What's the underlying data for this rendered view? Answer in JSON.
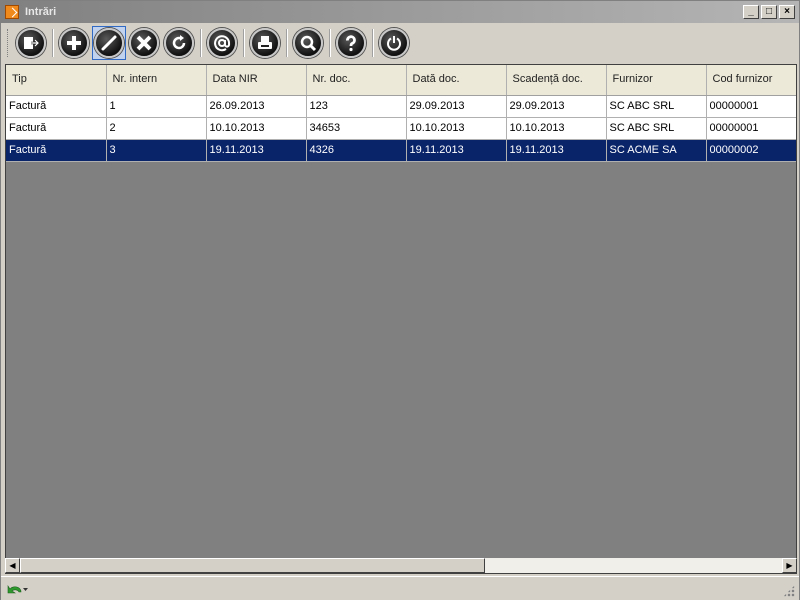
{
  "window": {
    "title": "Intrări"
  },
  "window_controls": {
    "minimize": "_",
    "maximize": "□",
    "close": "×"
  },
  "toolbar": {
    "buttons": [
      {
        "name": "exit-button",
        "icon": "exit-icon"
      },
      {
        "name": "add-button",
        "icon": "plus-icon"
      },
      {
        "name": "edit-button",
        "icon": "pencil-icon",
        "active": true
      },
      {
        "name": "delete-button",
        "icon": "x-icon"
      },
      {
        "name": "refresh-button",
        "icon": "refresh-icon"
      },
      {
        "name": "email-button",
        "icon": "at-icon"
      },
      {
        "name": "print-button",
        "icon": "printer-icon"
      },
      {
        "name": "search-button",
        "icon": "magnifier-icon"
      },
      {
        "name": "help-button",
        "icon": "question-icon"
      },
      {
        "name": "power-button",
        "icon": "power-icon"
      }
    ]
  },
  "grid": {
    "columns": [
      "Tip",
      "Nr. intern",
      "Data NIR",
      "Nr. doc.",
      "Dată doc.",
      "Scadență doc.",
      "Furnizor",
      "Cod furnizor"
    ],
    "rows": [
      [
        "Factură",
        "1",
        "26.09.2013",
        "123",
        "29.09.2013",
        "29.09.2013",
        "SC ABC SRL",
        "00000001"
      ],
      [
        "Factură",
        "2",
        "10.10.2013",
        "34653",
        "10.10.2013",
        "10.10.2013",
        "SC ABC SRL",
        "00000001"
      ],
      [
        "Factură",
        "3",
        "19.11.2013",
        "4326",
        "19.11.2013",
        "19.11.2013",
        "SC ACME SA",
        "00000002"
      ]
    ],
    "selected_row": 3
  },
  "scrollbar": {
    "left_arrow": "◀",
    "right_arrow": "▶",
    "position_fraction": 0.61
  },
  "statusbar": {
    "icon": "undo-arrow-icon"
  },
  "colors": {
    "selection": "#0a246a",
    "grid_background": "#808080",
    "titlebar": "#808080"
  }
}
